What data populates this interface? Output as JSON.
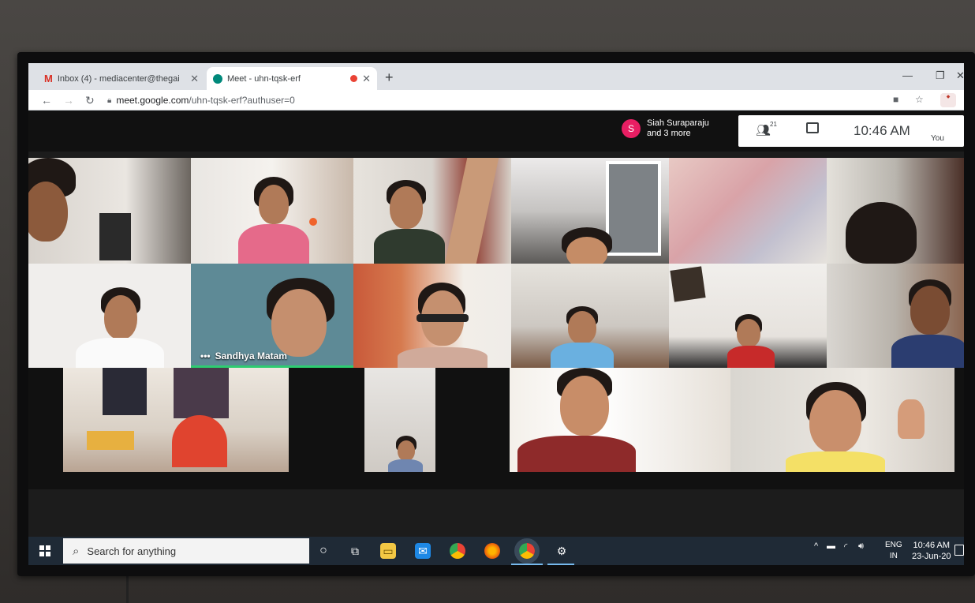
{
  "browser": {
    "tabs": [
      {
        "label": "Inbox (4) - mediacenter@thegai",
        "icon": "gmail-icon",
        "active": false
      },
      {
        "label": "Meet - uhn-tqsk-erf",
        "icon": "meet-icon",
        "active": true
      }
    ],
    "url_domain": "meet.google.com",
    "url_path": "/uhn-tqsk-erf?authuser=0"
  },
  "meet": {
    "presenter_initial": "S",
    "presenter_name": "Siah Suraparaju",
    "presenter_more": "and 3 more",
    "people_count": "21",
    "time": "10:46 AM",
    "you_label": "You",
    "active_speaker": "Sandhya Matam"
  },
  "taskbar": {
    "search_placeholder": "Search for anything",
    "lang_top": "ENG",
    "lang_bottom": "IN",
    "clock_time": "10:46 AM",
    "clock_date": "23-Jun-20"
  },
  "colors": {
    "avatar": "#e91e63",
    "active_speaker_border": "#2ecc71",
    "taskbar": "#1f2a36"
  }
}
